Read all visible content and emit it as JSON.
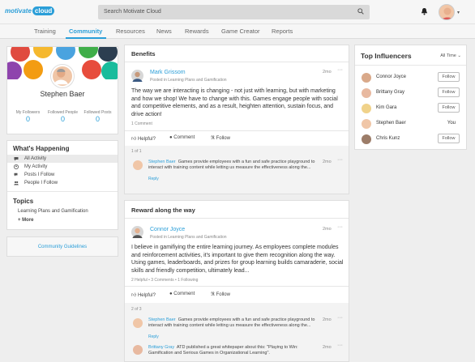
{
  "app": {
    "logo_text": "motivate",
    "logo_badge": "cloud"
  },
  "search": {
    "placeholder": "Search Motivate Cloud"
  },
  "nav": {
    "items": [
      "Training",
      "Community",
      "Resources",
      "News",
      "Rewards",
      "Game Creator",
      "Reports"
    ],
    "active": "Community"
  },
  "profile": {
    "name": "Stephen Baer",
    "stats": [
      {
        "label": "My Followers",
        "value": "0"
      },
      {
        "label": "Followed People",
        "value": "0"
      },
      {
        "label": "Followed Posts",
        "value": "0"
      }
    ]
  },
  "happening": {
    "title": "What's Happening",
    "items": [
      "All Activity",
      "My Activity",
      "Posts I Follow",
      "People I Follow"
    ],
    "selected": "All Activity"
  },
  "topics": {
    "title": "Topics",
    "items": [
      "Learning Plans and Gamification"
    ],
    "more": "+ More"
  },
  "guidelines": {
    "label": "Community Guidelines"
  },
  "posts": [
    {
      "title": "Benefits",
      "author": "Mark Grissom",
      "posted_in": "Posted in Learning Plans and Gamification",
      "time": "2mo",
      "body": "The way we are interacting is changing - not just with learning, but with marketing and how we shop! We have to change with this. Games engage people with social and competitive elements, and as a result, heighten attention, sustain focus, and drive action!",
      "meta": "1 Comment",
      "actions": [
        "Helpful?",
        "Comment",
        "Follow"
      ],
      "comment_count": "1 of 1",
      "comments": [
        {
          "author": "Stephen Baer",
          "text": "Games provide employees with a fun and safe practice playground to interact with training content while letting us measure the effectiveness along the...",
          "time": "2mo",
          "reply": "Reply"
        }
      ]
    },
    {
      "title": "Reward along the way",
      "author": "Connor Joyce",
      "posted_in": "Posted in Learning Plans and Gamification",
      "time": "2mo",
      "body": "I believe in gamifiying the entire learning journey. As employees complete modules and reinforcement activities, it's important to give them recognition along the way. Using games, leaderboards, and prizes for group learning builds camaraderie, social skills and friendly competition, ultimately lead...",
      "meta": "2 Helpful • 3 Comments • 1 Following",
      "actions": [
        "Helpful?",
        "Comment",
        "Follow"
      ],
      "comment_count": "2 of 3",
      "comments": [
        {
          "author": "Stephen Baer",
          "text": "Games provide employees with a fun and safe practice playground to interact with training content while letting us measure the effectiveness along the...",
          "time": "2mo",
          "reply": "Reply"
        },
        {
          "author": "Brittany Gray",
          "text": "ATD published a great whitepaper about this: \"Playing to Win: Gamification and Serious Games in Organizational Learning\".",
          "time": "2mo",
          "reply": ""
        }
      ]
    }
  ],
  "influencers": {
    "title": "Top Influencers",
    "filter": "All Time",
    "people": [
      {
        "name": "Connor Joyce",
        "action": "Follow"
      },
      {
        "name": "Brittany Gray",
        "action": "Follow"
      },
      {
        "name": "Kim Gara",
        "action": "Follow"
      },
      {
        "name": "Stephen Baer",
        "action": "You"
      },
      {
        "name": "Chris Kunz",
        "action": "Follow"
      }
    ]
  }
}
